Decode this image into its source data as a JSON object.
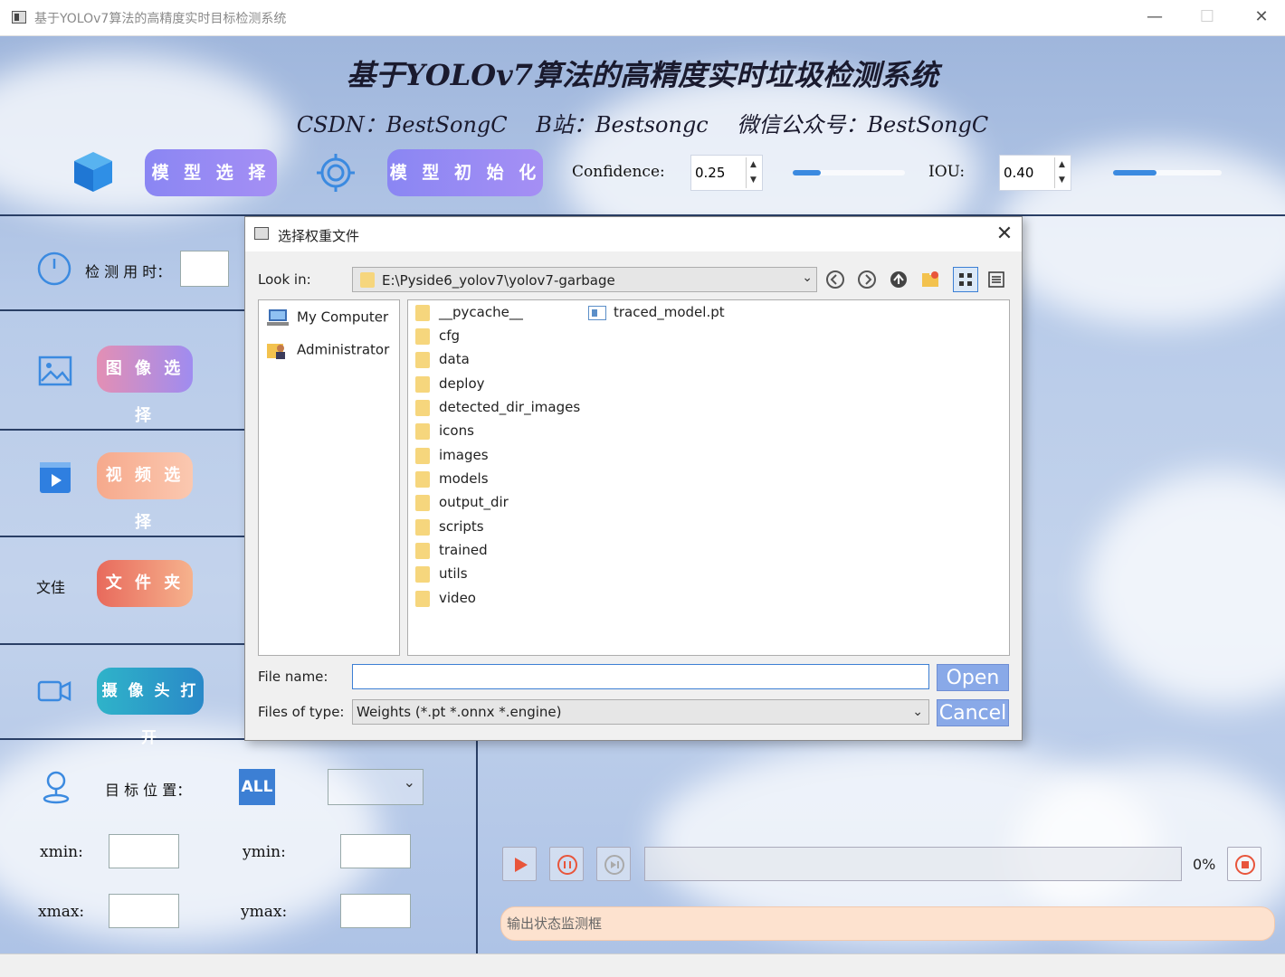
{
  "window": {
    "title": "基于YOLOv7算法的高精度实时目标检测系统",
    "controls": {
      "minimize": "—",
      "maximize": "☐",
      "close": "✕"
    }
  },
  "header": {
    "title": "基于YOLOv7算法的高精度实时垃圾检测系统",
    "subtitle": [
      "CSDN：BestSongC",
      "B站：Bestsongc",
      "微信公众号：BestSongC"
    ]
  },
  "toolbar": {
    "model_select_label": "模 型 选 择",
    "model_init_label": "模 型 初 始 化",
    "confidence_label": "Confidence:",
    "confidence_value": "0.25",
    "confidence_level": 0.25,
    "iou_label": "IOU:",
    "iou_value": "0.40",
    "iou_level": 0.4,
    "spin_up": "▲",
    "spin_down": "▼"
  },
  "left_panel": {
    "detect_time_label": "检 测 用 时：",
    "detect_time_value": "",
    "image_select_label": "图 像 选 择",
    "video_select_label": "视 频 选 择",
    "folder_text_label": "文佳",
    "folder_label": "文 件 夹",
    "camera_label": "摄 像 头 打 开",
    "target_position_label": "目 标 位 置：",
    "all_button": "ALL",
    "xmin_label": "xmin:",
    "ymin_label": "ymin:",
    "xmax_label": "xmax:",
    "ymax_label": "ymax:"
  },
  "media": {
    "progress_text": "0%",
    "progress_level": 0,
    "status_placeholder": "输出状态监测框"
  },
  "colors": {
    "accent": "#3b8ae0",
    "pill_purple": "#8a86f3",
    "status_peach": "#fde2cf",
    "play_red": "#e8553b"
  },
  "dialog": {
    "title": "选择权重文件",
    "close": "✕",
    "look_in_label": "Look in:",
    "look_in_path": "E:\\Pyside6_yolov7\\yolov7-garbage",
    "combo_arrow": "⌄",
    "nav_icons": [
      "back-icon",
      "forward-icon",
      "up-icon",
      "new-folder-icon",
      "list-view-icon",
      "detail-view-icon"
    ],
    "places": [
      "My Computer",
      "Administrator"
    ],
    "files": [
      "__pycache__",
      "cfg",
      "data",
      "deploy",
      "detected_dir_images",
      "icons",
      "images",
      "models",
      "output_dir",
      "scripts",
      "trained",
      "utils",
      "video"
    ],
    "weight_file": "traced_model.pt",
    "file_name_label": "File name:",
    "file_name_value": "",
    "files_of_type_label": "Files of type:",
    "files_of_type_value": "Weights (*.pt *.onnx *.engine)",
    "open_button": "Open",
    "cancel_button": "Cancel"
  }
}
